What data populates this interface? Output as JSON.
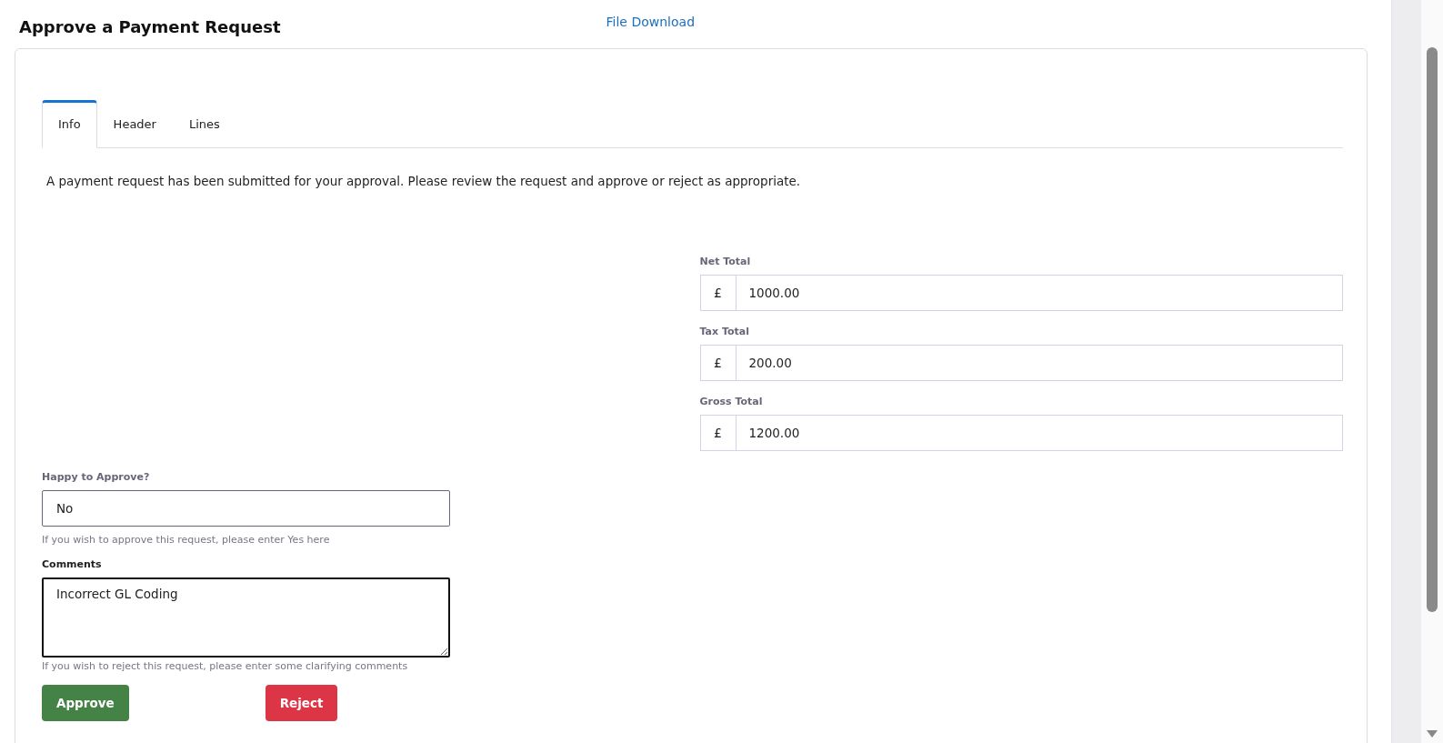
{
  "page": {
    "title": "Approve a Payment Request",
    "link": "File Download"
  },
  "tabs": [
    {
      "label": "Info",
      "selected": true
    },
    {
      "label": "Header",
      "selected": false
    },
    {
      "label": "Lines",
      "selected": false
    }
  ],
  "intro": "A payment request has been submitted for your approval. Please review the request and approve or reject as appropriate.",
  "totals": [
    {
      "label": "Net Total",
      "currency": "£",
      "value": "1000.00"
    },
    {
      "label": "Tax Total",
      "currency": "£",
      "value": "200.00"
    },
    {
      "label": "Gross Total",
      "currency": "£",
      "value": "1200.00"
    }
  ],
  "approval": {
    "label": "Happy to Approve?",
    "value": "No",
    "help": "If you wish to approve this request, please enter Yes here"
  },
  "comments": {
    "label": "Comments",
    "value": "Incorrect GL Coding",
    "focused": true,
    "help": "If you wish to reject this request, please enter some clarifying comments"
  },
  "buttons": [
    {
      "label": "Approve",
      "kind": "approve"
    },
    {
      "label": "Reject",
      "kind": "reject"
    }
  ]
}
